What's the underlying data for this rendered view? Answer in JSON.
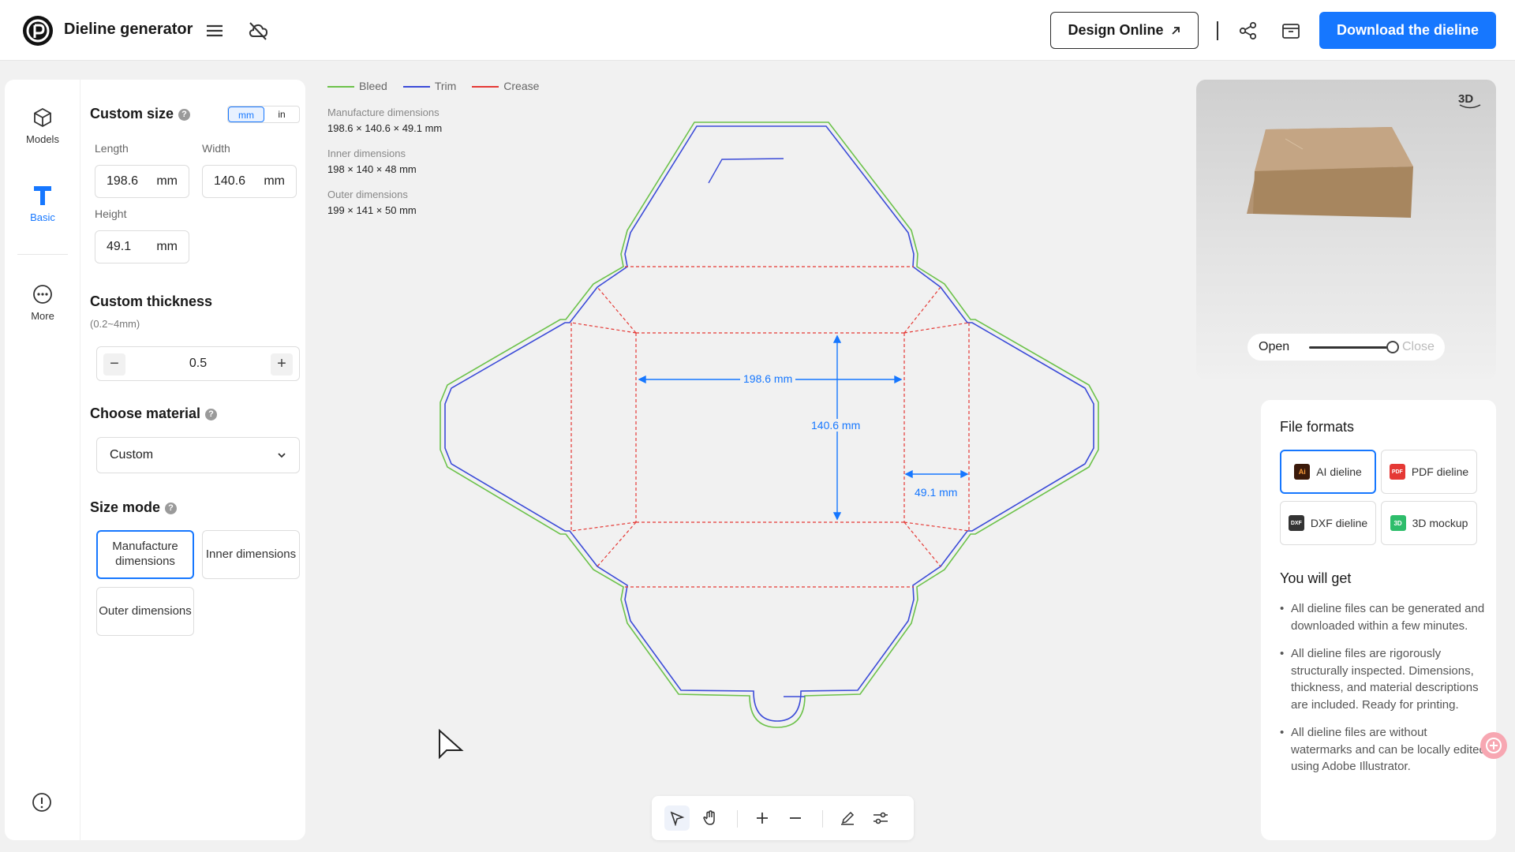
{
  "header": {
    "app_title": "Dieline generator",
    "design_online_label": "Design Online",
    "download_label": "Download the dieline",
    "accent_color": "#1677ff"
  },
  "rail": {
    "items": [
      {
        "label": "Models",
        "icon": "cube-icon"
      },
      {
        "label": "Basic",
        "icon": "tshirt-icon",
        "active": true
      },
      {
        "label": "More",
        "icon": "more-icon"
      }
    ]
  },
  "settings": {
    "custom_size_title": "Custom size",
    "units": [
      "mm",
      "in"
    ],
    "active_unit": "mm",
    "length_label": "Length",
    "length_value": "198.6",
    "length_unit": "mm",
    "width_label": "Width",
    "width_value": "140.6",
    "width_unit": "mm",
    "height_label": "Height",
    "height_value": "49.1",
    "height_unit": "mm",
    "thickness_title": "Custom thickness",
    "thickness_range": "(0.2~4mm)",
    "thickness_value": "0.5",
    "material_title": "Choose material",
    "material_value": "Custom",
    "size_mode_title": "Size mode",
    "size_modes": [
      {
        "label": "Manufacture dimensions",
        "active": true
      },
      {
        "label": "Inner dimensions",
        "active": false
      },
      {
        "label": "Outer dimensions",
        "active": false
      }
    ]
  },
  "canvas": {
    "legend": [
      {
        "label": "Bleed",
        "color": "#6cc24a"
      },
      {
        "label": "Trim",
        "color": "#3b4bd8"
      },
      {
        "label": "Crease",
        "color": "#e53935"
      }
    ],
    "dims": [
      {
        "label": "Manufacture dimensions",
        "value": "198.6 × 140.6 × 49.1 mm"
      },
      {
        "label": "Inner dimensions",
        "value": "198 × 140 × 48 mm"
      },
      {
        "label": "Outer dimensions",
        "value": "199 × 141 × 50 mm"
      }
    ],
    "length_dim": "198.6 mm",
    "width_dim": "140.6 mm",
    "height_dim": "49.1 mm"
  },
  "preview": {
    "badge": "3D",
    "open_label": "Open",
    "close_label": "Close",
    "open_close_level": 1.0
  },
  "formats": {
    "title": "File formats",
    "items": [
      {
        "label": "AI dieline",
        "icon": "ai-file-icon",
        "icon_text": "Ai",
        "color": "#3b1a0a",
        "active": true
      },
      {
        "label": "PDF dieline",
        "icon": "pdf-file-icon",
        "icon_text": "PDF",
        "color": "#e53935",
        "active": false
      },
      {
        "label": "DXF dieline",
        "icon": "dxf-file-icon",
        "icon_text": "DXF",
        "color": "#333333",
        "active": false
      },
      {
        "label": "3D mockup",
        "icon": "mockup-icon",
        "icon_text": "3D",
        "color": "#2ebd6b",
        "active": false
      }
    ],
    "you_will_get_title": "You will get",
    "benefits": [
      "All dieline files can be generated and downloaded within a few minutes.",
      "All dieline files are rigorously structurally inspected. Dimensions, thickness, and material descriptions are included. Ready for printing.",
      "All dieline files are without watermarks and can be locally edited using Adobe Illustrator."
    ]
  }
}
